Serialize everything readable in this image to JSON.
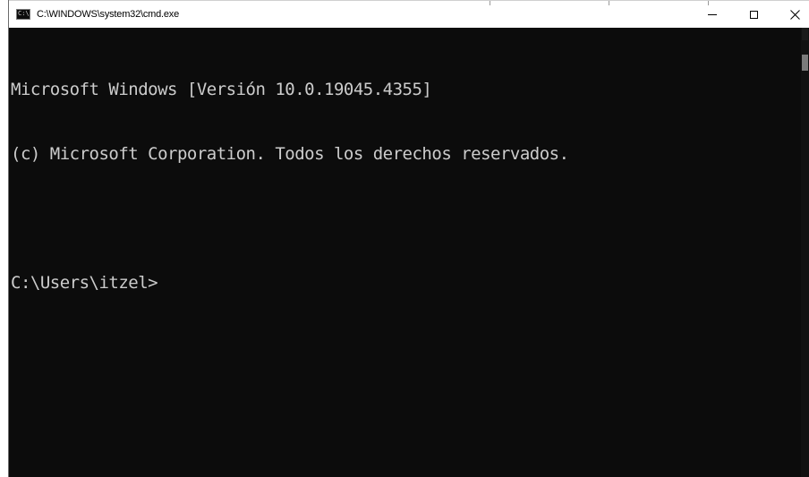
{
  "window": {
    "title": "C:\\WINDOWS\\system32\\cmd.exe",
    "icon_glyph": "C:\\"
  },
  "console": {
    "lines": [
      "Microsoft Windows [Versión 10.0.19045.4355]",
      "(c) Microsoft Corporation. Todos los derechos reservados.",
      "",
      "C:\\Users\\itzel>"
    ]
  },
  "colors": {
    "console_bg": "#0c0c0c",
    "console_fg": "#cccccc",
    "titlebar_bg": "#ffffff"
  }
}
